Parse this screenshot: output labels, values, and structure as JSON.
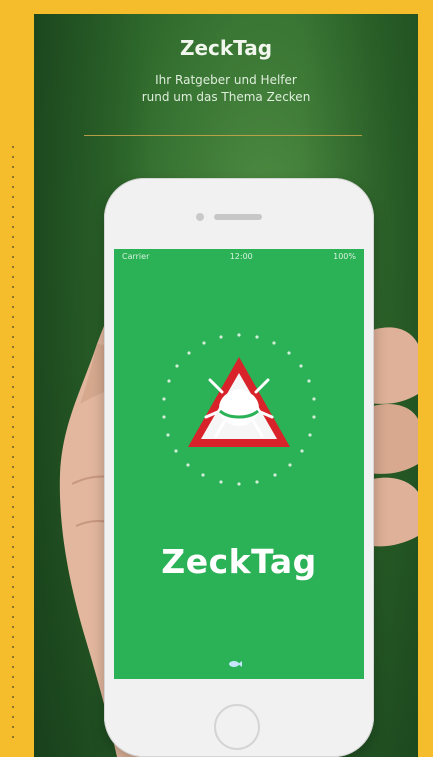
{
  "banner": {
    "title": "ZeckTag",
    "subtitle_line1": "Ihr Ratgeber und Helfer",
    "subtitle_line2": "rund um das Thema Zecken"
  },
  "phone": {
    "statusbar": {
      "carrier": "Carrier",
      "time": "12:00",
      "battery": "100%"
    },
    "app_name": "ZeckTag",
    "footer_icon": "fish-icon"
  },
  "colors": {
    "left_strip": "#f5bd2c",
    "screen_green": "#2bb156",
    "warning_red": "#d8232a"
  }
}
